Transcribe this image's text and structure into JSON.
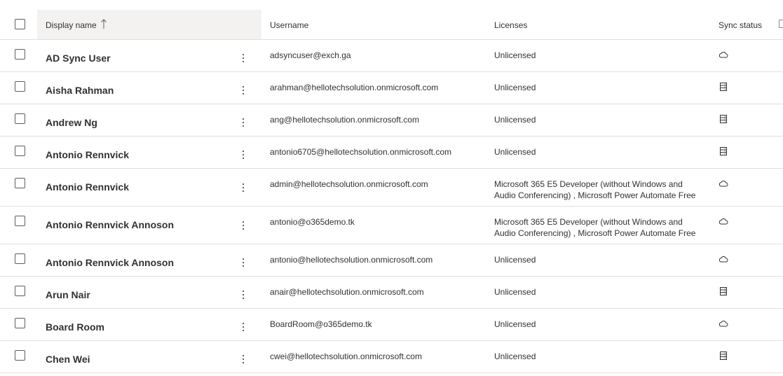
{
  "columns": {
    "display_name": "Display name",
    "sort_arrow": "↑",
    "username": "Username",
    "licenses": "Licenses",
    "sync_status": "Sync status"
  },
  "icons": {
    "cloud": "cloud-icon",
    "directory": "directory-sync-icon",
    "more": "more-vertical-icon",
    "sort": "sort-ascending-icon"
  },
  "colors": {
    "header_sorted_bg": "#f3f2f1",
    "divider": "#e1dfdd",
    "text": "#323130",
    "checkbox_border": "#605e5c"
  },
  "rows": [
    {
      "name": "AD Sync User",
      "username": "adsyncuser@exch.ga",
      "licenses": "Unlicensed",
      "sync": "cloud"
    },
    {
      "name": "Aisha Rahman",
      "username": "arahman@hellotechsolution.onmicrosoft.com",
      "licenses": "Unlicensed",
      "sync": "directory"
    },
    {
      "name": "Andrew Ng",
      "username": "ang@hellotechsolution.onmicrosoft.com",
      "licenses": "Unlicensed",
      "sync": "directory"
    },
    {
      "name": "Antonio Rennvick",
      "username": "antonio6705@hellotechsolution.onmicrosoft.com",
      "licenses": "Unlicensed",
      "sync": "directory"
    },
    {
      "name": "Antonio Rennvick",
      "username": "admin@hellotechsolution.onmicrosoft.com",
      "licenses": "Microsoft 365 E5 Developer (without Windows and Audio Conferencing) , Microsoft Power Automate Free",
      "sync": "cloud"
    },
    {
      "name": "Antonio Rennvick Annoson",
      "username": "antonio@o365demo.tk",
      "licenses": "Microsoft 365 E5 Developer (without Windows and Audio Conferencing) , Microsoft Power Automate Free",
      "sync": "cloud"
    },
    {
      "name": "Antonio Rennvick Annoson",
      "username": "antonio@hellotechsolution.onmicrosoft.com",
      "licenses": "Unlicensed",
      "sync": "cloud"
    },
    {
      "name": "Arun Nair",
      "username": "anair@hellotechsolution.onmicrosoft.com",
      "licenses": "Unlicensed",
      "sync": "directory"
    },
    {
      "name": "Board Room",
      "username": "BoardRoom@o365demo.tk",
      "licenses": "Unlicensed",
      "sync": "cloud"
    },
    {
      "name": "Chen Wei",
      "username": "cwei@hellotechsolution.onmicrosoft.com",
      "licenses": "Unlicensed",
      "sync": "directory"
    }
  ]
}
